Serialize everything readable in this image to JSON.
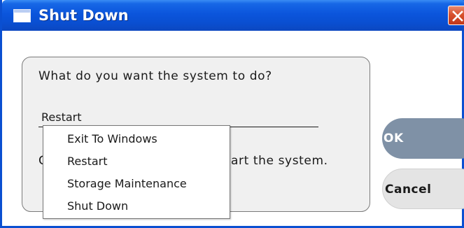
{
  "window": {
    "title": "Shut Down"
  },
  "dialog": {
    "prompt": "What do you want the system to do?",
    "selected_option": "Restart",
    "description_left": "C",
    "description_right": "art the system.",
    "options": [
      "Exit To Windows",
      "Restart",
      "Storage Maintenance",
      "Shut Down"
    ]
  },
  "buttons": {
    "ok_label": "OK",
    "cancel_label": "Cancel"
  },
  "icons": {
    "title": "window-icon",
    "close": "close-icon"
  },
  "colors": {
    "titlebar": "#0a4fd1",
    "close_button": "#d8512d",
    "ok_button": "#7f91a6",
    "cancel_button": "#e4e4e4"
  }
}
